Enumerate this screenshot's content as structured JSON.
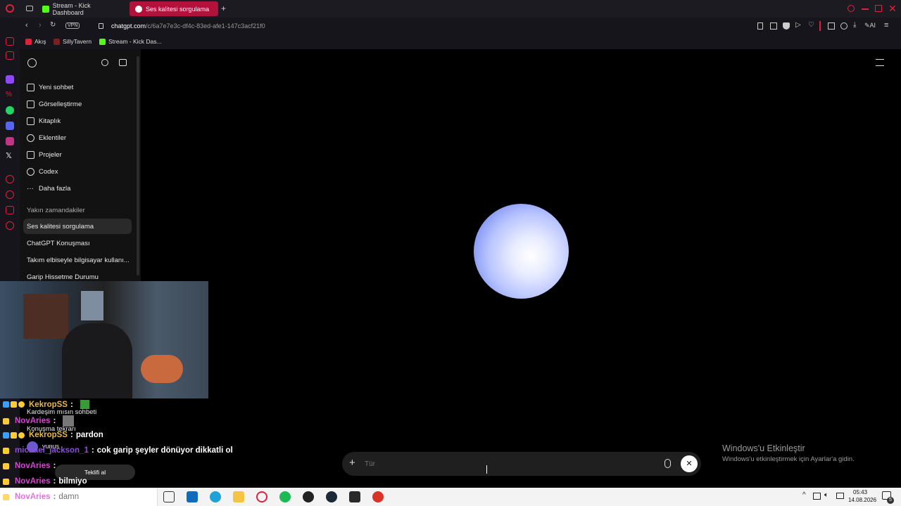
{
  "browser": {
    "tabs": [
      {
        "label": "Stream - Kick Dashboard",
        "active": false
      },
      {
        "label": "Ses kalitesi sorgulama",
        "active": true
      }
    ],
    "new_tab": "+",
    "url_domain": "chatgpt.com",
    "url_path": "/c/6a7e7e3c-df4c-83ed-afe1-147c3acf21f0",
    "vpn_label": "VPN",
    "ai_label": "AI",
    "bookmarks": [
      "Akış",
      "SillyTavern",
      "Stream - Kick Das..."
    ]
  },
  "sidebar": {
    "items": [
      {
        "label": "Yeni sohbet",
        "icon": "edit-icon"
      },
      {
        "label": "Görselleştirme",
        "icon": "image-icon"
      },
      {
        "label": "Kitaplık",
        "icon": "library-icon"
      },
      {
        "label": "Eklentiler",
        "icon": "apps-icon"
      },
      {
        "label": "Projeler",
        "icon": "folder-icon"
      },
      {
        "label": "Codex",
        "icon": "codex-icon"
      },
      {
        "label": "Daha fazla",
        "icon": "more-icon"
      }
    ],
    "recent_heading": "Yakın zamandakiler",
    "recent": [
      "Ses kalitesi sorgulama",
      "ChatGPT Konuşması",
      "Takım elbiseyle bilgisayar kullanı...",
      "Garip Hissetme Durumu",
      "Kardeşim mısın sohbeti",
      "Konuşma tekrarı"
    ],
    "user_name": "yunus",
    "upgrade_label": "Teklifi al"
  },
  "composer": {
    "placeholder": "Tür"
  },
  "stream_chat": [
    {
      "user": "KekropSS",
      "color": "#e9b84a",
      "message": ""
    },
    {
      "user": "NovAries",
      "color": "#d04ad0",
      "message": ""
    },
    {
      "user": "KekropSS",
      "color": "#e9b84a",
      "message": "pardon"
    },
    {
      "user": "michael_jackson_1",
      "color": "#8a4fd8",
      "message": "cok garip şeyler dönüyor dikkatli ol"
    },
    {
      "user": "NovAries",
      "color": "#d04ad0",
      "message": ""
    },
    {
      "user": "NovAries",
      "color": "#d04ad0",
      "message": "bilmiyo"
    },
    {
      "user": "NovAries",
      "color": "#d04ad0",
      "message": "damn"
    }
  ],
  "watermark": {
    "title": "Windows'u Etkinleştir",
    "subtitle": "Windows'u etkinleştirmek için Ayarlar'a gidin."
  },
  "taskbar": {
    "time": "05:43",
    "date": "14.08.2026",
    "notif_count": "5"
  }
}
